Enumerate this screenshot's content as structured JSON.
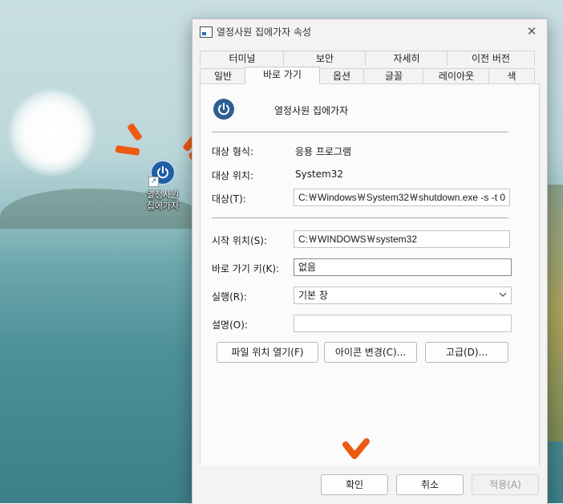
{
  "desktop": {
    "shortcut": {
      "label": "열정사원\n집에가자",
      "icon": "power-icon"
    },
    "accent_color": "#ee5a12"
  },
  "dialog": {
    "title": "열정사원 집에가자 속성",
    "close_icon": "close-icon",
    "tabs_row1": [
      "터미널",
      "보안",
      "자세히",
      "이전 버전"
    ],
    "tabs_row2": [
      "일반",
      "바로 가기",
      "옵션",
      "글꼴",
      "레이아웃",
      "색"
    ],
    "active_tab": "바로 가기",
    "shortcut": {
      "name": "열정사원 집에가자",
      "target_type_label": "대상 형식:",
      "target_type_value": "응용 프로그램",
      "target_location_label": "대상 위치:",
      "target_location_value": "System32",
      "target_label": "대상(T):",
      "target_value": "C:￦Windows￦System32￦shutdown.exe -s -t 0",
      "start_in_label": "시작 위치(S):",
      "start_in_value": "C:￦WINDOWS￦system32",
      "shortcut_key_label": "바로 가기 키(K):",
      "shortcut_key_value": "없음",
      "run_label": "실행(R):",
      "run_value": "기본 창",
      "comment_label": "설명(O):",
      "comment_value": ""
    },
    "buttons": {
      "open_location": "파일 위치 열기(F)",
      "change_icon": "아이콘 변경(C)...",
      "advanced": "고급(D)..."
    },
    "footer": {
      "ok": "확인",
      "cancel": "취소",
      "apply": "적용(A)"
    }
  }
}
